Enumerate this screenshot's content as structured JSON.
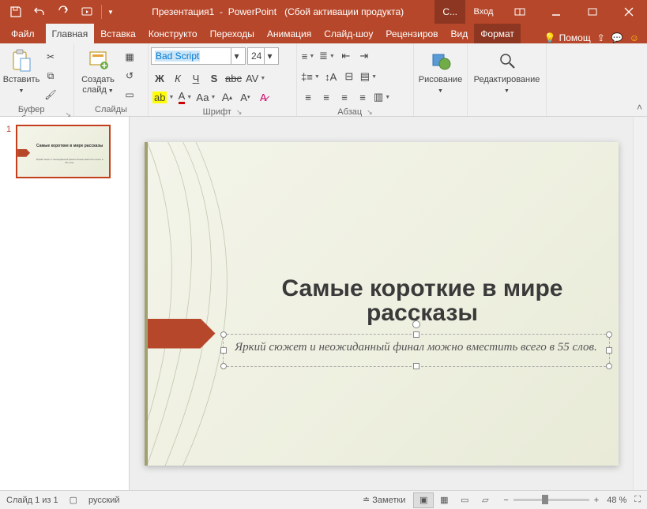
{
  "titlebar": {
    "doc_name": "Презентация1",
    "app": "PowerPoint",
    "activation": "(Сбой активации продукта)",
    "sign_in_prefix": "С...",
    "sign_in": "Вход"
  },
  "tabs": {
    "file": "Файл",
    "home": "Главная",
    "insert": "Вставка",
    "design": "Конструкто",
    "transitions": "Переходы",
    "animations": "Анимация",
    "slideshow": "Слайд-шоу",
    "review": "Рецензиров",
    "view": "Вид",
    "format": "Формат",
    "tell_me": "Помощ"
  },
  "ribbon": {
    "clipboard": {
      "paste": "Вставить",
      "label": "Буфер обмена"
    },
    "slides": {
      "new_slide": "Создать слайд",
      "label": "Слайды"
    },
    "font": {
      "name": "Bad Script",
      "size": "24",
      "label": "Шрифт"
    },
    "paragraph": {
      "label": "Абзац"
    },
    "drawing": {
      "label": "Рисование"
    },
    "editing": {
      "label": "Редактирование"
    }
  },
  "thumbnail": {
    "num": "1",
    "title": "Самые короткие в мире рассказы",
    "subtitle": "Яркий сюжет и неожиданный финал можно вместить всего в 55 слов."
  },
  "slide": {
    "title": "Самые короткие в мире рассказы",
    "subtitle": "Яркий сюжет и неожиданный финал можно вместить всего в 55 слов."
  },
  "status": {
    "slide_info": "Слайд 1 из 1",
    "language": "русский",
    "notes": "Заметки",
    "zoom": "48 %"
  }
}
